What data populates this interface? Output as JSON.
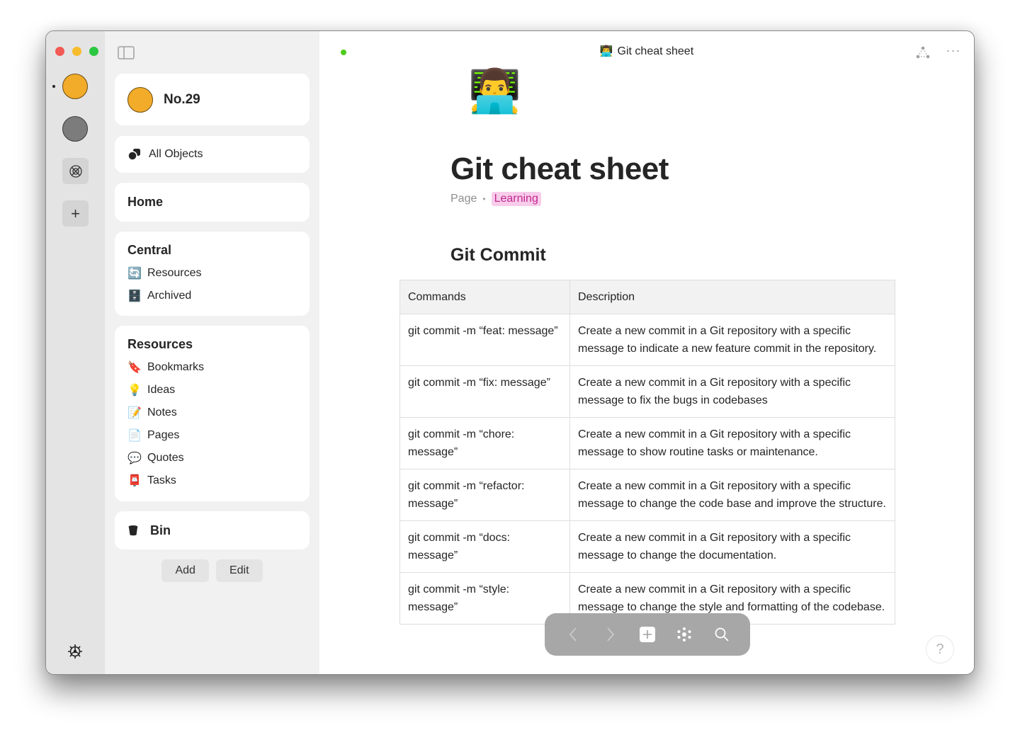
{
  "window": {
    "title": "Git cheat sheet"
  },
  "rail": {
    "spaces": [
      {
        "name": "yellow-space",
        "color": "#f2ac2a",
        "active": true
      },
      {
        "name": "gray-space",
        "color": "#7c7c7c",
        "active": false
      }
    ],
    "gallery_icon": "gallery-icon",
    "add_icon": "+",
    "settings_icon": "gear-icon"
  },
  "sidebar": {
    "space_name": "No.29",
    "all_objects": "All Objects",
    "home": "Home",
    "central": {
      "title": "Central",
      "items": [
        {
          "emoji": "🔄",
          "label": "Resources"
        },
        {
          "emoji": "🗄️",
          "label": "Archived"
        }
      ]
    },
    "resources": {
      "title": "Resources",
      "items": [
        {
          "emoji": "🔖",
          "label": "Bookmarks"
        },
        {
          "emoji": "💡",
          "label": "Ideas"
        },
        {
          "emoji": "📝",
          "label": "Notes"
        },
        {
          "emoji": "📄",
          "label": "Pages"
        },
        {
          "emoji": "💬",
          "label": "Quotes"
        },
        {
          "emoji": "📮",
          "label": "Tasks"
        }
      ]
    },
    "bin": "Bin",
    "add_label": "Add",
    "edit_label": "Edit"
  },
  "header": {
    "emoji": "👨‍💻",
    "title": "Git cheat sheet",
    "sync_color": "#4ccd1c"
  },
  "page": {
    "icon": "👨‍💻",
    "title": "Git cheat sheet",
    "type": "Page",
    "separator": "•",
    "tag": "Learning",
    "tag_color": "#c2278f",
    "tag_bg": "#f8ccea",
    "section_title": "Git Commit",
    "table": {
      "headers": [
        "Commands",
        "Description"
      ],
      "rows": [
        {
          "command": "git commit -m “feat: message”",
          "description": "Create a new commit in a Git repository with a specific message to indicate a new feature commit in the repository."
        },
        {
          "command": "git commit -m “fix: message”",
          "description": "Create a new commit in a Git repository with a specific message to fix the bugs in codebases"
        },
        {
          "command": "git commit -m “chore: message”",
          "description": "Create a new commit in a Git repository with a specific message to show routine tasks or maintenance."
        },
        {
          "command": "git commit -m “refactor: message”",
          "description": "Create a new commit in a Git repository with a specific message to change the code base and improve the structure."
        },
        {
          "command": "git commit -m “docs: message”",
          "description": "Create a new commit in a Git repository with a specific message to change the documentation."
        },
        {
          "command": "git commit -m “style: message”",
          "description": "Create a new commit in a Git repository with a specific message to change the style and formatting of the codebase."
        }
      ]
    }
  },
  "floating_toolbar": {
    "back": "back-icon",
    "forward": "forward-icon",
    "create": "plus-icon",
    "graph": "graph-icon",
    "search": "search-icon"
  },
  "help": "?"
}
